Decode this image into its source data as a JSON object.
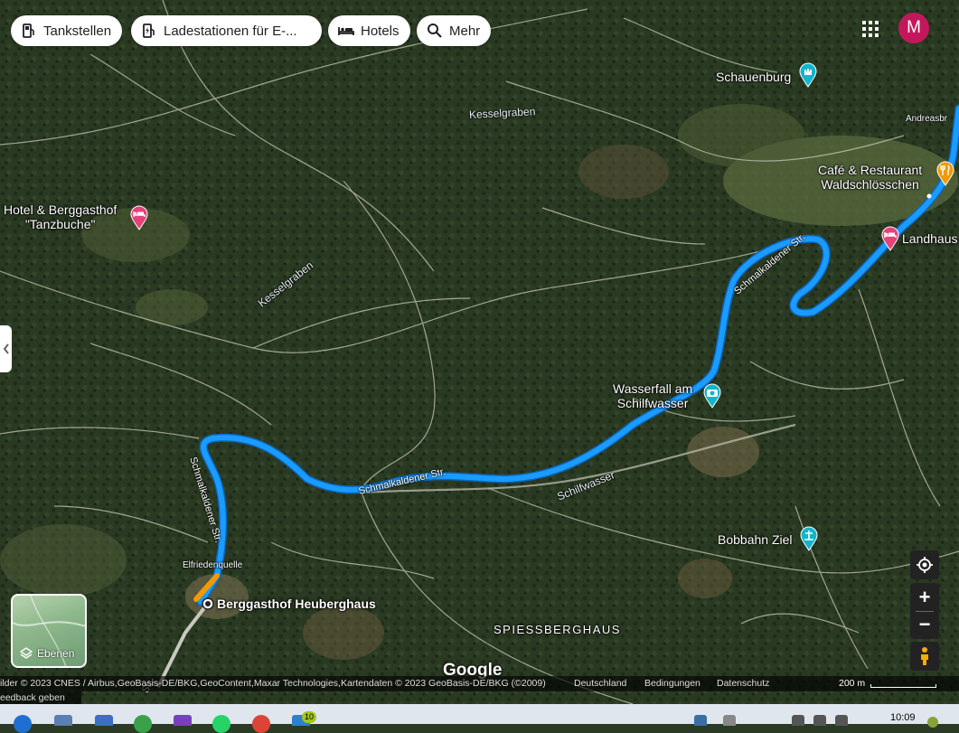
{
  "filters": {
    "gas": "Tankstellen",
    "charging": "Ladestationen für E-...",
    "hotels": "Hotels",
    "more": "Mehr"
  },
  "account": {
    "avatar_letter": "M",
    "avatar_color": "#c2185b"
  },
  "places": {
    "schauenburg": "Schauenburg",
    "cafe_line1": "Café & Restaurant",
    "cafe_line2": "Waldschlösschen",
    "hotel_line1": "Hotel & Berggasthof",
    "hotel_line2": "\"Tanzbuche\"",
    "landhaus": "Landhaus",
    "andreas": "Andreasbr",
    "waterfall_line1": "Wasserfall am",
    "waterfall_line2": "Schilfwasser",
    "bobbahn": "Bobbahn Ziel",
    "destination": "Berggasthof Heuberghaus",
    "elfrieden": "Elfriedenquelle",
    "area": "SPIESSBERGHAUS"
  },
  "roads": {
    "kesselgraben_1": "Kesselgraben",
    "kesselgraben_2": "Kesselgraben",
    "schmal_1": "Schmalkaldener Str.",
    "schmal_2": "Schmalkaldener Str.",
    "schmal_3": "Schmalkaldener Str.",
    "schilfwasser": "Schilfwasser",
    "str_bottom": "Str."
  },
  "map_controls": {
    "layers_label": "Ebenen",
    "zoom_in": "+",
    "zoom_out": "−"
  },
  "google_logo": "Google",
  "attribution": {
    "imagery": "ilder © 2023 CNES / Airbus,GeoBasis-DE/BKG,GeoContent,Maxar Technologies,Kartendaten © 2023 GeoBasis-DE/BKG (©2009)",
    "country": "Deutschland",
    "terms": "Bedingungen",
    "privacy": "Datenschutz",
    "scale": "200 m",
    "feedback": "eedback geben"
  },
  "taskbar": {
    "mail_badge": "10",
    "clock": "10:09"
  },
  "colors": {
    "route": "#1a9cff",
    "route_walk": "#f29900",
    "hotel_pin": "#e6417a",
    "sight_pin": "#12b5cb",
    "food_pin": "#f29900"
  }
}
